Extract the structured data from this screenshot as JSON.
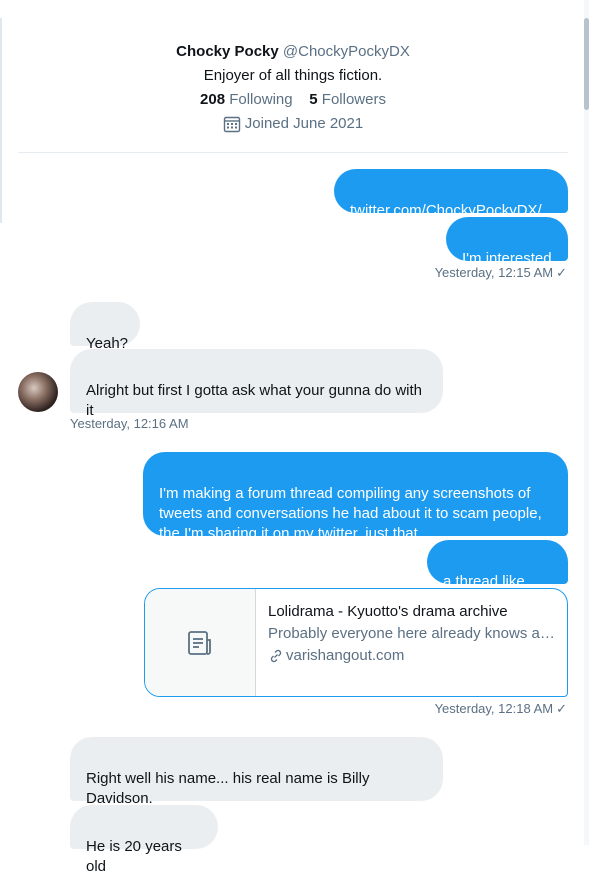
{
  "profile": {
    "name": "Chocky Pocky",
    "handle": "@ChockyPockyDX",
    "bio": "Enjoyer of all things fiction.",
    "following_count": "208",
    "following_label": "Following",
    "followers_count": "5",
    "followers_label": "Followers",
    "joined": "Joined June 2021",
    "joined_icon": "calendar-icon"
  },
  "messages": [
    {
      "from": "me",
      "text": "twitter.com/ChockyPockyDX/...",
      "is_link": true
    },
    {
      "from": "me",
      "text": "I'm interested"
    },
    {
      "timestamp": "Yesterday, 12:15 AM",
      "read_mark": "✓"
    },
    {
      "from": "them",
      "text": "Yeah?"
    },
    {
      "from": "them",
      "text": "Alright but first I gotta ask what your gunna do with it"
    },
    {
      "timestamp": "Yesterday, 12:16 AM"
    },
    {
      "from": "me",
      "text": "I'm making a forum thread compiling any screenshots of tweets and conversations he had about it to scam people, the I'm sharing it on my twitter, just that"
    },
    {
      "from": "me",
      "text": "a thread like this"
    },
    {
      "from": "me",
      "card": {
        "title": "Lolidrama - Kyuotto's drama archive",
        "description": "Probably everyone here already knows ab...",
        "domain": "varishangout.com",
        "thumb_icon": "document-icon",
        "domain_icon": "link-icon"
      }
    },
    {
      "timestamp": "Yesterday, 12:18 AM",
      "read_mark": "✓"
    },
    {
      "from": "them",
      "text": "Right well his name... his real name is Billy Davidson."
    },
    {
      "from": "them",
      "text": "He is 20 years old"
    }
  ]
}
